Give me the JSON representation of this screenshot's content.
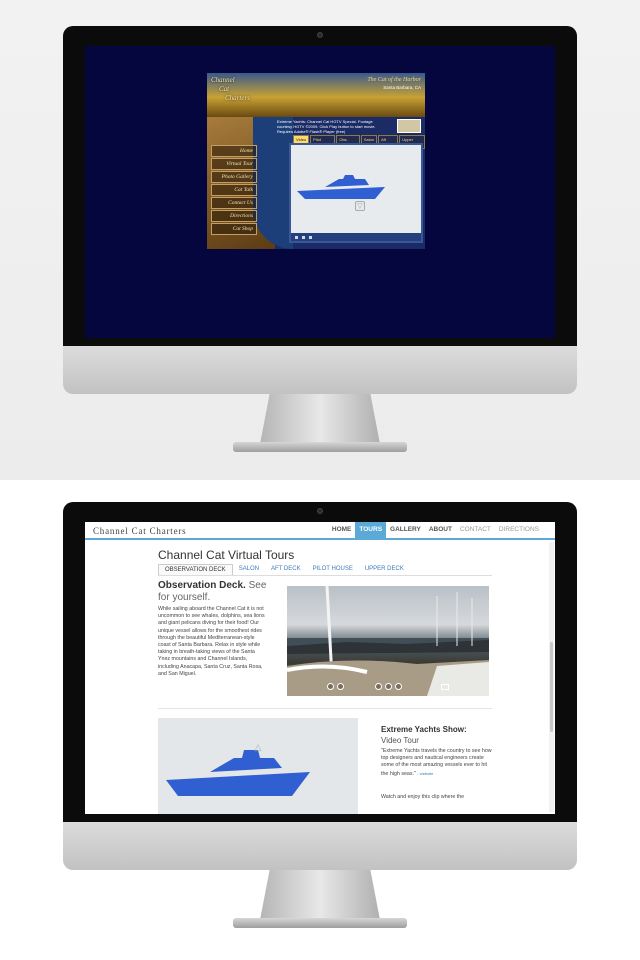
{
  "old_site": {
    "logo_lines": [
      "Channel",
      "Cat",
      "Charters"
    ],
    "tagline": "The Cat of the Harbor",
    "location": "Santa Barbara, CA",
    "video_caption": "Extreme Yachts: Channel Cat HGTV Special. Footage courtesy HGTV ©2009. Click Play button to start movie. Requires Adobe® Flash® Player (free)",
    "tabs": [
      "Video",
      "Pilot House",
      "Obs. Deck",
      "Salon",
      "Aft Deck",
      "Upper Deck"
    ],
    "nav": [
      "Home",
      "Virtual Tour",
      "Photo Gallery",
      "Cat Talk",
      "Contact Us",
      "Directions",
      "Cat Shop"
    ]
  },
  "new_site": {
    "brand": "Channel Cat Charters",
    "nav": [
      {
        "label": "HOME"
      },
      {
        "label": "TOURS"
      },
      {
        "label": "GALLERY"
      },
      {
        "label": "ABOUT"
      },
      {
        "label": "CONTACT"
      },
      {
        "label": "DIRECTIONS"
      }
    ],
    "page_title": "Channel Cat Virtual Tours",
    "subtabs": [
      "OBSERVATION DECK",
      "SALON",
      "AFT DECK",
      "PILOT HOUSE",
      "UPPER DECK"
    ],
    "observation": {
      "heading": "Observation Deck.",
      "heading_light": "See for yourself.",
      "body": "While sailing aboard the Channel Cat it is not uncommon to see whales, dolphins, sea lions and giant pelicans diving for their food! Our unique vessel allows for the smoothest rides through the beautiful Mediterranean-style coast of Santa Barbara. Relax in style while taking in breath-taking views of the Santa Ynez mountains and Channel Islands, including Anacapa, Santa Cruz, Santa Rosa, and San Miguel."
    },
    "extreme": {
      "heading": "Extreme Yachts Show:",
      "sub": "Video Tour",
      "quote": "\"Extreme Yachts travels the country to see how top designers and nautical engineers create some of the most amazing vessels ever to hit the high seas.\"",
      "more": "- website",
      "body2": "Watch and enjoy this clip where the"
    }
  }
}
